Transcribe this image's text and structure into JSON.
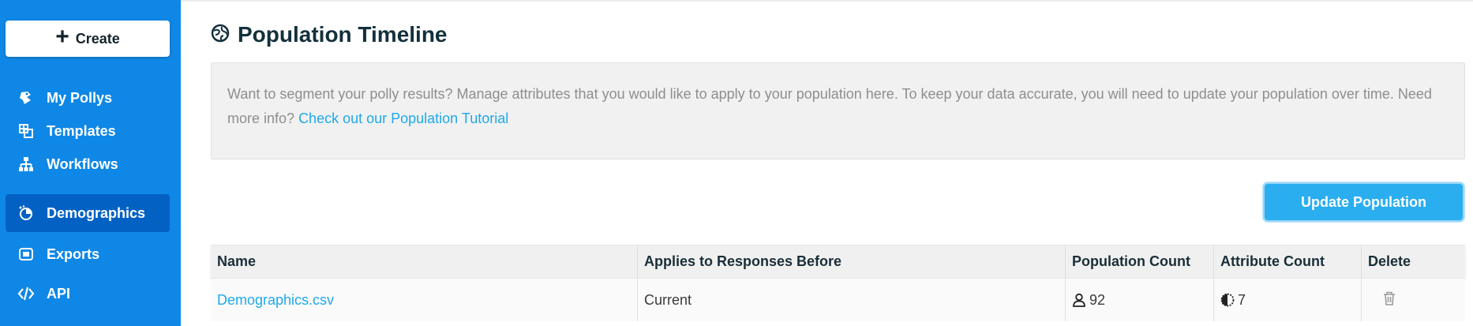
{
  "sidebar": {
    "create_label": "Create",
    "items": [
      {
        "label": "My Pollys",
        "icon": "pollys-icon"
      },
      {
        "label": "Templates",
        "icon": "templates-icon"
      },
      {
        "label": "Workflows",
        "icon": "workflows-icon"
      },
      {
        "label": "Demographics",
        "icon": "demographics-icon",
        "active": true
      },
      {
        "label": "Exports",
        "icon": "exports-icon"
      },
      {
        "label": "API",
        "icon": "code-icon"
      }
    ]
  },
  "header": {
    "title": "Population Timeline",
    "icon": "globe-icon"
  },
  "info": {
    "text": "Want to segment your polly results? Manage attributes that you would like to apply to your population here. To keep your data accurate, you will need to update your population over time. Need more info?",
    "link": "Check out our Population Tutorial"
  },
  "actions": {
    "update_label": "Update Population"
  },
  "table": {
    "columns": [
      "Name",
      "Applies to Responses Before",
      "Population Count",
      "Attribute Count",
      "Delete"
    ],
    "rows": [
      {
        "name": "Demographics.csv",
        "applies": "Current",
        "population": "92",
        "attributes": "7"
      }
    ]
  },
  "colors": {
    "sidebar": "#0f87e6",
    "active": "#0461c4",
    "link": "#1fa9ea",
    "button": "#2aaef0"
  }
}
